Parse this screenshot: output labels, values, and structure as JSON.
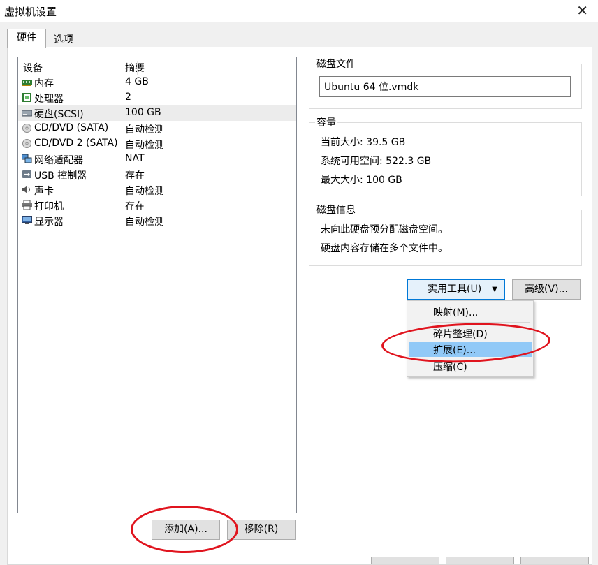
{
  "window": {
    "title": "虚拟机设置"
  },
  "tabs": [
    {
      "label": "硬件"
    },
    {
      "label": "选项"
    }
  ],
  "device_list": {
    "headers": {
      "device": "设备",
      "summary": "摘要"
    },
    "rows": [
      {
        "name": "内存",
        "summary": "4 GB",
        "icon": "memory-icon"
      },
      {
        "name": "处理器",
        "summary": "2",
        "icon": "processor-icon"
      },
      {
        "name": "硬盘(SCSI)",
        "summary": "100 GB",
        "icon": "hard-disk-icon",
        "selected": true
      },
      {
        "name": "CD/DVD (SATA)",
        "summary": "自动检测",
        "icon": "cd-dvd-icon"
      },
      {
        "name": "CD/DVD 2 (SATA)",
        "summary": "自动检测",
        "icon": "cd-dvd-icon"
      },
      {
        "name": "网络适配器",
        "summary": "NAT",
        "icon": "network-adapter-icon"
      },
      {
        "name": "USB 控制器",
        "summary": "存在",
        "icon": "usb-icon"
      },
      {
        "name": "声卡",
        "summary": "自动检测",
        "icon": "sound-card-icon"
      },
      {
        "name": "打印机",
        "summary": "存在",
        "icon": "printer-icon"
      },
      {
        "name": "显示器",
        "summary": "自动检测",
        "icon": "display-icon"
      }
    ]
  },
  "buttons": {
    "add": "添加(A)...",
    "remove": "移除(R)",
    "utilities": "实用工具(U)",
    "advanced": "高级(V)..."
  },
  "disk_file": {
    "title": "磁盘文件",
    "value": "Ubuntu 64 位.vmdk"
  },
  "capacity": {
    "title": "容量",
    "current": "当前大小: 39.5 GB",
    "available": "系统可用空间: 522.3 GB",
    "max": "最大大小: 100 GB"
  },
  "disk_info": {
    "title": "磁盘信息",
    "line1": "未向此硬盘预分配磁盘空间。",
    "line2": "硬盘内容存储在多个文件中。"
  },
  "utilities_menu": {
    "items": [
      {
        "label": "映射(M)..."
      },
      {
        "label": "碎片整理(D)"
      },
      {
        "label": "扩展(E)...",
        "highlighted": true
      },
      {
        "label": "压缩(C)"
      }
    ]
  },
  "colors": {
    "annotation": "#e0141e",
    "highlight": "#91c9f7",
    "selection": "#ececec"
  }
}
